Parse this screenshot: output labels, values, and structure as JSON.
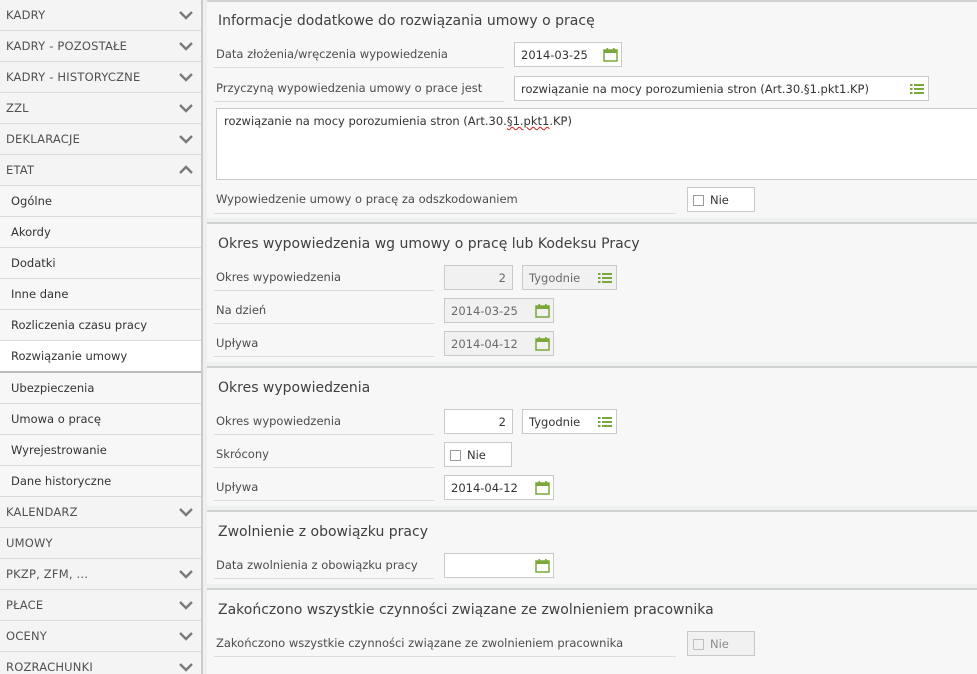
{
  "sidebar": {
    "items": [
      {
        "label": "KADRY",
        "state": "collapsed"
      },
      {
        "label": "KADRY - POZOSTAŁE",
        "state": "collapsed"
      },
      {
        "label": "KADRY - HISTORYCZNE",
        "state": "collapsed"
      },
      {
        "label": "ZZL",
        "state": "collapsed"
      },
      {
        "label": "DEKLARACJE",
        "state": "collapsed"
      },
      {
        "label": "ETAT",
        "state": "expanded"
      },
      {
        "label": "Ogólne"
      },
      {
        "label": "Akordy"
      },
      {
        "label": "Dodatki"
      },
      {
        "label": "Inne dane"
      },
      {
        "label": "Rozliczenia czasu pracy"
      },
      {
        "label": "Rozwiązanie umowy",
        "active": true
      },
      {
        "label": "Ubezpieczenia"
      },
      {
        "label": "Umowa o pracę"
      },
      {
        "label": "Wyrejestrowanie"
      },
      {
        "label": "Dane historyczne"
      },
      {
        "label": "KALENDARZ",
        "state": "collapsed"
      },
      {
        "label": "UMOWY"
      },
      {
        "label": "PKZP, ZFM, ...",
        "state": "collapsed"
      },
      {
        "label": "PŁACE",
        "state": "collapsed"
      },
      {
        "label": "OCENY",
        "state": "collapsed"
      },
      {
        "label": "ROZRACHUNKI",
        "state": "collapsed"
      }
    ]
  },
  "s1": {
    "title": "Informacje dodatkowe do rozwiązania umowy o pracę",
    "date_label": "Data złożenia/wręczenia wypowiedzenia",
    "date_value": "2014-03-25",
    "reason_label": "Przyczyną wypowiedzenia umowy o prace jest",
    "reason_value": "rozwiązanie na mocy porozumienia stron (Art.30.§1.pkt1.KP)",
    "textarea_value_prefix": "rozwiązanie na mocy porozumienia stron (Art.30.",
    "textarea_value_spell": "§1.pkt1",
    "textarea_value_suffix": ".KP)",
    "comp_label": "Wypowiedzenie umowy o pracę za odszkodowaniem",
    "comp_value": "Nie"
  },
  "s2": {
    "title": "Okres wypowiedzenia wg umowy o pracę lub Kodeksu Pracy",
    "period_label": "Okres wypowiedzenia",
    "period_value": "2",
    "period_unit": "Tygodnie",
    "day_label": "Na dzień",
    "day_value": "2014-03-25",
    "expires_label": "Upływa",
    "expires_value": "2014-04-12"
  },
  "s3": {
    "title": "Okres wypowiedzenia",
    "period_label": "Okres wypowiedzenia",
    "period_value": "2",
    "period_unit": "Tygodnie",
    "short_label": "Skrócony",
    "short_value": "Nie",
    "expires_label": "Upływa",
    "expires_value": "2014-04-12"
  },
  "s4": {
    "title": "Zwolnienie z obowiązku pracy",
    "date_label": "Data zwolnienia z obowiązku pracy",
    "date_value": ""
  },
  "s5": {
    "title": "Zakończono wszystkie czynności związane ze zwolnieniem pracownika",
    "done_label": "Zakończono wszystkie czynności związane ze zwolnieniem pracownika",
    "done_value": "Nie"
  },
  "colors": {
    "accent_green": "#7aa83a",
    "border": "#c8cac9",
    "label_text": "#4c4c4c"
  }
}
